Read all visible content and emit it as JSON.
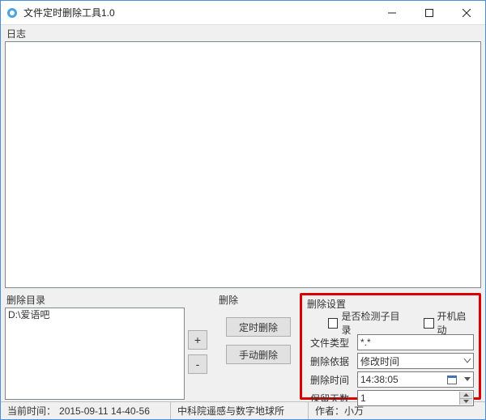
{
  "window": {
    "title": "文件定时删除工具1.0"
  },
  "log": {
    "label": "日志"
  },
  "dir": {
    "label": "删除目录",
    "items": [
      "D:\\爱语吧"
    ]
  },
  "addremove": {
    "add": "+",
    "remove": "-"
  },
  "del": {
    "label": "删除",
    "timed": "定时删除",
    "manual": "手动删除"
  },
  "settings": {
    "title": "删除设置",
    "check_subdir": "是否检测子目录",
    "check_autostart": "开机启动",
    "filetype_label": "文件类型",
    "filetype_value": "*.*",
    "basis_label": "删除依据",
    "basis_value": "修改时间",
    "time_label": "删除时间",
    "time_value": "14:38:05",
    "keepdays_label": "保留天数",
    "keepdays_value": "1"
  },
  "status": {
    "now_label": "当前时间：",
    "now_value": "2015-09-11 14-40-56",
    "org": "中科院遥感与数字地球所",
    "author_label": "作者：",
    "author_value": "小万"
  }
}
